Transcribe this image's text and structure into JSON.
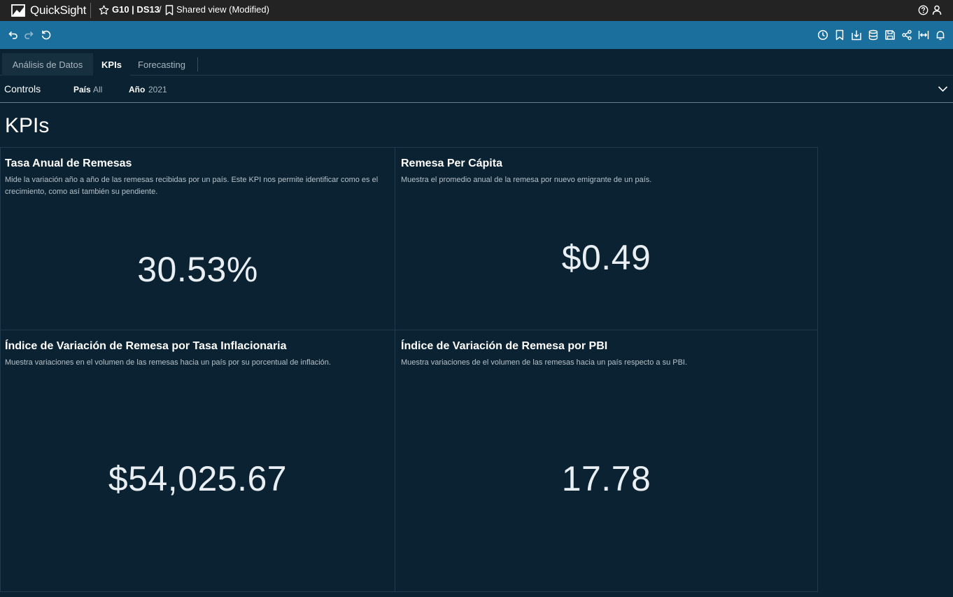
{
  "topbar": {
    "app_name": "QuickSight",
    "dashboard_name": "G10 | DS13",
    "separator": "/",
    "view_name": "Shared view (Modified)"
  },
  "tabs": [
    {
      "label": "Análisis de Datos",
      "active": false
    },
    {
      "label": "KPIs",
      "active": true
    },
    {
      "label": "Forecasting",
      "active": false
    }
  ],
  "controls": {
    "label": "Controls",
    "items": [
      {
        "name": "País",
        "value": "All"
      },
      {
        "name": "Año",
        "value": "2021"
      }
    ]
  },
  "sheet": {
    "title": "KPIs"
  },
  "kpis": [
    {
      "title": "Tasa Anual de Remesas",
      "description": "Mide la variación año a año de las remesas recibidas por un país. Este KPI nos permite identificar como es el crecimiento, como así también su pendiente.",
      "value": "30.53%"
    },
    {
      "title": "Remesa Per Cápita",
      "description": "Muestra el promedio anual de la remesa por nuevo emigrante de un país.",
      "value": "$0.49"
    },
    {
      "title": "Índice de Variación de Remesa por Tasa Inflacionaria",
      "description": "Muestra variaciones en el volumen de las remesas hacia un país por su porcentual de inflación.",
      "value": "$54,025.67"
    },
    {
      "title": "Índice de Variación de Remesa por PBI",
      "description": "Muestra variaciones de el volumen de las remesas hacia un país respecto a su PBI.",
      "value": "17.78"
    }
  ],
  "colors": {
    "topbar_bg": "#232323",
    "toolbar_bg": "#1a6f9c",
    "canvas_bg": "#0a2232"
  }
}
